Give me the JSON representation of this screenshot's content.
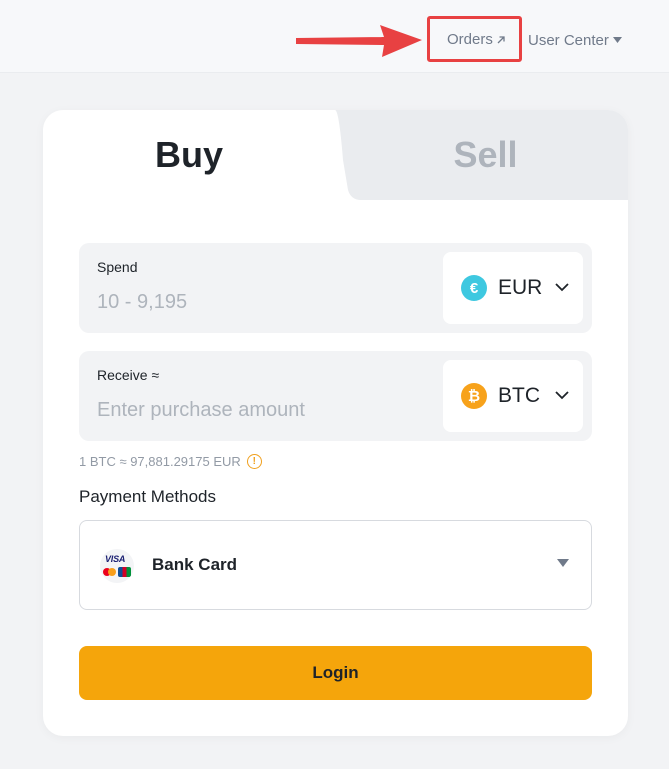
{
  "header": {
    "orders_label": "Orders",
    "user_center_label": "User Center"
  },
  "tabs": {
    "buy_label": "Buy",
    "sell_label": "Sell"
  },
  "spend": {
    "label": "Spend",
    "placeholder": "10 - 9,195",
    "currency": "EUR",
    "currency_symbol": "€"
  },
  "receive": {
    "label": "Receive ≈",
    "placeholder": "Enter purchase amount",
    "currency": "BTC",
    "currency_symbol": "₿"
  },
  "rate_text": "1 BTC ≈ 97,881.29175 EUR",
  "payment": {
    "label": "Payment Methods",
    "selected": "Bank Card",
    "logo_text": "VISA"
  },
  "login_label": "Login",
  "colors": {
    "accent": "#f5a50b",
    "highlight": "#e84142",
    "eur": "#3ec8e0",
    "btc": "#f7a21b"
  }
}
